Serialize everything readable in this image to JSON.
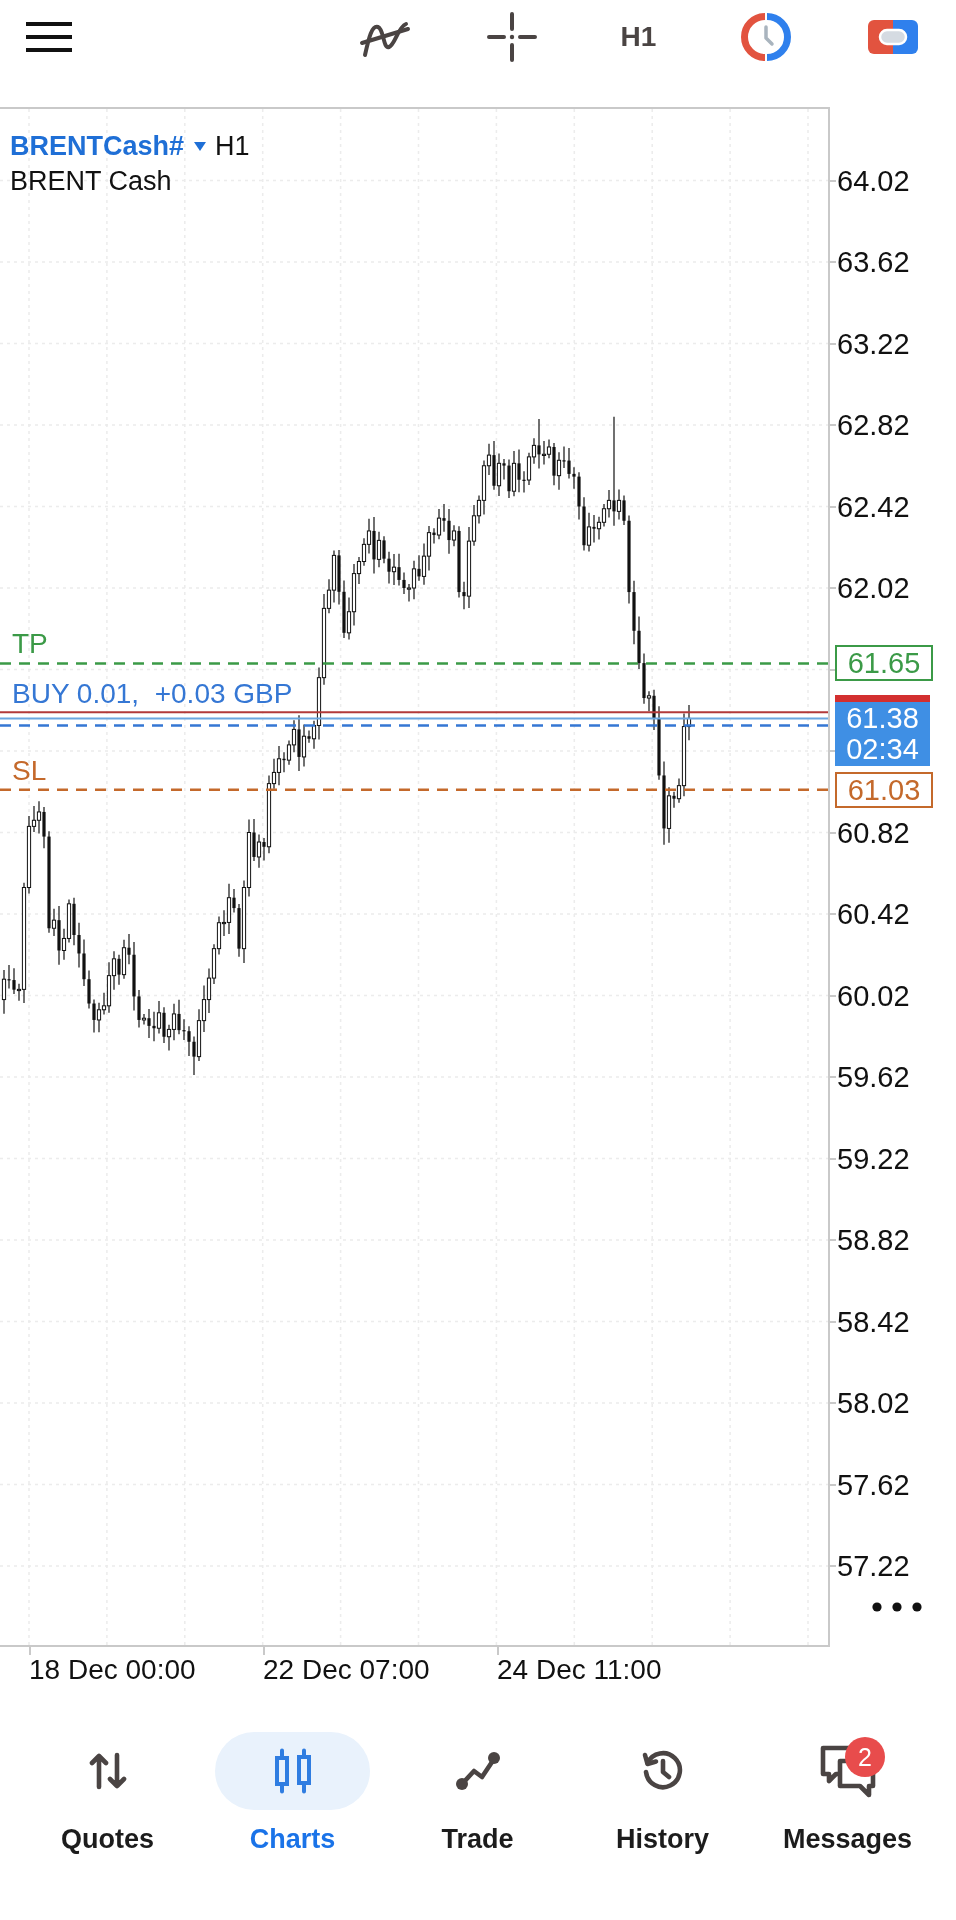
{
  "top_bar": {
    "timeframe": "H1"
  },
  "chart": {
    "symbol": "BRENTCash#",
    "timeframe": "H1",
    "description": "BRENT Cash",
    "levels": [
      {
        "kind": "take_profit",
        "label": "TP",
        "price": "61.65",
        "color": "#3b9a47"
      },
      {
        "kind": "position",
        "label": "BUY 0.01,  +0.03 GBP",
        "color": "#3577d4"
      },
      {
        "kind": "stop_loss",
        "label": "SL",
        "price": "61.03",
        "color": "#c4692b"
      }
    ],
    "price_axis": [
      "64.02",
      "63.62",
      "63.22",
      "62.82",
      "62.42",
      "62.02",
      "60.82",
      "60.42",
      "60.02",
      "59.62",
      "59.22",
      "58.82",
      "58.42",
      "58.02",
      "57.62",
      "57.22"
    ],
    "current_price": {
      "price": "61.38",
      "time_left": "02:34"
    },
    "time_axis": [
      "18 Dec 00:00",
      "22 Dec 07:00",
      "24 Dec 11:00"
    ]
  },
  "bottom_nav": [
    {
      "label": "Quotes",
      "selected": false
    },
    {
      "label": "Charts",
      "selected": true
    },
    {
      "label": "Trade",
      "selected": false
    },
    {
      "label": "History",
      "selected": false
    },
    {
      "label": "Messages",
      "selected": false,
      "badge": "2"
    }
  ]
}
